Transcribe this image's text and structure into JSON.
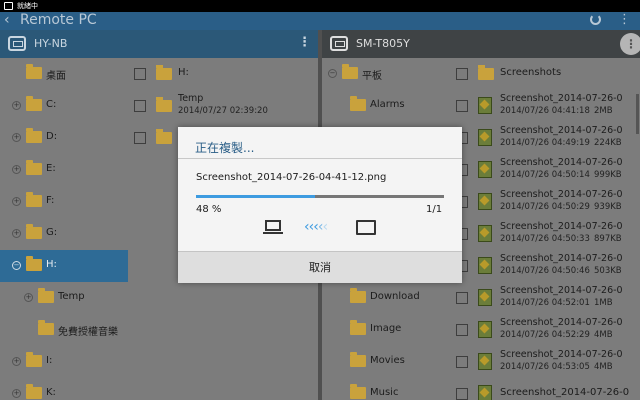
{
  "status_bar": {
    "text": "就緒中"
  },
  "app_bar": {
    "back_glyph": "‹",
    "title": "Remote PC",
    "menu_glyph": "⋮"
  },
  "left_pane": {
    "device_name": "HY-NB",
    "menu_glyph": "⋮",
    "tree": [
      {
        "label": "桌面",
        "expander": ""
      },
      {
        "label": "C:",
        "expander": "+"
      },
      {
        "label": "D:",
        "expander": "+"
      },
      {
        "label": "E:",
        "expander": "+"
      },
      {
        "label": "F:",
        "expander": "+"
      },
      {
        "label": "G:",
        "expander": "+"
      },
      {
        "label": "H:",
        "expander": "−",
        "selected": true
      },
      {
        "label": "Temp",
        "expander": "+"
      },
      {
        "label": "免費授權音樂",
        "expander": ""
      },
      {
        "label": "I:",
        "expander": "+"
      },
      {
        "label": "K:",
        "expander": "+"
      }
    ],
    "list": [
      {
        "name": "H:",
        "date": ""
      },
      {
        "name": "Temp",
        "date": "2014/07/27 02:39:20"
      },
      {
        "name": "",
        "date": ""
      }
    ]
  },
  "right_pane": {
    "device_name": "SM-T805Y",
    "menu_glyph": "⋮",
    "tree": [
      {
        "label": "平板",
        "expander": "−"
      },
      {
        "label": "Alarms",
        "expander": ""
      },
      {
        "label": "",
        "expander": ""
      },
      {
        "label": "",
        "expander": ""
      },
      {
        "label": "",
        "expander": ""
      },
      {
        "label": "",
        "expander": ""
      },
      {
        "label": "",
        "expander": ""
      },
      {
        "label": "Download",
        "expander": ""
      },
      {
        "label": "Image",
        "expander": ""
      },
      {
        "label": "Movies",
        "expander": ""
      },
      {
        "label": "Music",
        "expander": ""
      }
    ],
    "list": [
      {
        "name": "Screenshots",
        "type": "folder"
      },
      {
        "name": "Screenshot_2014-07-26-0",
        "date": "2014/07/26 04:41:18",
        "size": "2MB",
        "type": "image"
      },
      {
        "name": "Screenshot_2014-07-26-0",
        "date": "2014/07/26 04:49:19",
        "size": "224KB",
        "type": "image"
      },
      {
        "name": "Screenshot_2014-07-26-0",
        "date": "2014/07/26 04:50:14",
        "size": "999KB",
        "type": "image"
      },
      {
        "name": "Screenshot_2014-07-26-0",
        "date": "2014/07/26 04:50:29",
        "size": "939KB",
        "type": "image"
      },
      {
        "name": "Screenshot_2014-07-26-0",
        "date": "2014/07/26 04:50:33",
        "size": "897KB",
        "type": "image"
      },
      {
        "name": "Screenshot_2014-07-26-0",
        "date": "2014/07/26 04:50:46",
        "size": "503KB",
        "type": "image"
      },
      {
        "name": "Screenshot_2014-07-26-0",
        "date": "2014/07/26 04:52:01",
        "size": "1MB",
        "type": "image"
      },
      {
        "name": "Screenshot_2014-07-26-0",
        "date": "2014/07/26 04:52:29",
        "size": "4MB",
        "type": "image"
      },
      {
        "name": "Screenshot_2014-07-26-0",
        "date": "2014/07/26 04:53:05",
        "size": "4MB",
        "type": "image"
      },
      {
        "name": "Screenshot_2014-07-26-0",
        "date": "",
        "size": "",
        "type": "image"
      }
    ]
  },
  "copy_dialog": {
    "title": "正在複製...",
    "file_name": "Screenshot_2014-07-26-04-41-12.png",
    "progress_fraction": 0.48,
    "percent_text": "48 %",
    "count_text": "1/1",
    "source_icon": "laptop-icon",
    "target_icon": "tablet-icon",
    "arrows": [
      "‹",
      "‹",
      "‹",
      "‹",
      "‹"
    ],
    "cancel_label": "取消",
    "progress_color": "#3d9be0"
  },
  "colors": {
    "accent": "#2a5e87",
    "selection": "#2e6b96",
    "folder": "#c9a23c"
  }
}
